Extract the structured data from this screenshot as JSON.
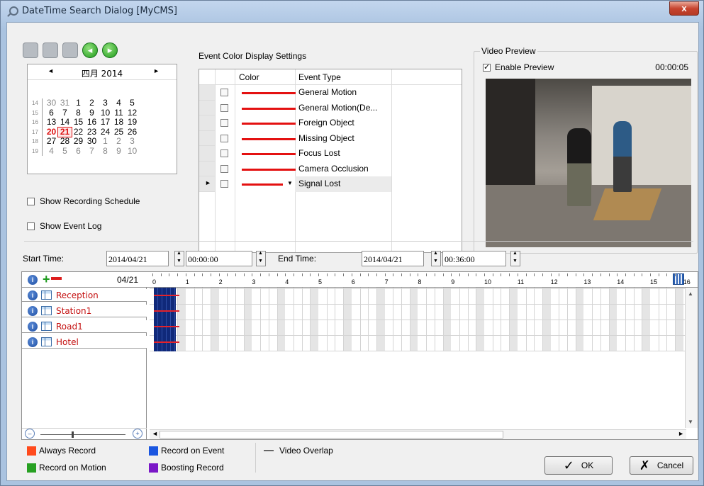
{
  "window": {
    "title": "DateTime Search Dialog [MyCMS]",
    "close_label": "x"
  },
  "toolbar": {
    "icons": [
      "link-icon",
      "search-camera-icon",
      "export-icon",
      "prev-green-icon",
      "next-green-icon"
    ]
  },
  "calendar": {
    "month_label": "四月 2014",
    "prev": "◄",
    "next": "►",
    "weeks": [
      {
        "wk": "14",
        "days": [
          {
            "d": "30",
            "c": "dim"
          },
          {
            "d": "31",
            "c": "dim"
          },
          {
            "d": "1",
            "c": ""
          },
          {
            "d": "2",
            "c": ""
          },
          {
            "d": "3",
            "c": ""
          },
          {
            "d": "4",
            "c": ""
          },
          {
            "d": "5",
            "c": ""
          }
        ]
      },
      {
        "wk": "15",
        "days": [
          {
            "d": "6",
            "c": ""
          },
          {
            "d": "7",
            "c": ""
          },
          {
            "d": "8",
            "c": ""
          },
          {
            "d": "9",
            "c": ""
          },
          {
            "d": "10",
            "c": ""
          },
          {
            "d": "11",
            "c": ""
          },
          {
            "d": "12",
            "c": ""
          }
        ]
      },
      {
        "wk": "16",
        "days": [
          {
            "d": "13",
            "c": ""
          },
          {
            "d": "14",
            "c": ""
          },
          {
            "d": "15",
            "c": ""
          },
          {
            "d": "16",
            "c": ""
          },
          {
            "d": "17",
            "c": ""
          },
          {
            "d": "18",
            "c": ""
          },
          {
            "d": "19",
            "c": ""
          }
        ]
      },
      {
        "wk": "17",
        "days": [
          {
            "d": "20",
            "c": "hl"
          },
          {
            "d": "21",
            "c": "sel"
          },
          {
            "d": "22",
            "c": ""
          },
          {
            "d": "23",
            "c": ""
          },
          {
            "d": "24",
            "c": ""
          },
          {
            "d": "25",
            "c": ""
          },
          {
            "d": "26",
            "c": ""
          }
        ]
      },
      {
        "wk": "18",
        "days": [
          {
            "d": "27",
            "c": ""
          },
          {
            "d": "28",
            "c": ""
          },
          {
            "d": "29",
            "c": ""
          },
          {
            "d": "30",
            "c": ""
          },
          {
            "d": "1",
            "c": "dim"
          },
          {
            "d": "2",
            "c": "dim"
          },
          {
            "d": "3",
            "c": "dim"
          }
        ]
      },
      {
        "wk": "19",
        "days": [
          {
            "d": "4",
            "c": "dim"
          },
          {
            "d": "5",
            "c": "dim"
          },
          {
            "d": "6",
            "c": "dim"
          },
          {
            "d": "7",
            "c": "dim"
          },
          {
            "d": "8",
            "c": "dim"
          },
          {
            "d": "9",
            "c": "dim"
          },
          {
            "d": "10",
            "c": "dim"
          }
        ]
      }
    ]
  },
  "options": {
    "show_recording_schedule": "Show Recording Schedule",
    "show_event_log": "Show Event Log"
  },
  "event_settings": {
    "label": "Event Color Display Settings",
    "col_color": "Color",
    "col_type": "Event Type",
    "line_color": "#e41111",
    "rows": [
      "General Motion",
      "General Motion(De...",
      "Foreign Object",
      "Missing Object",
      "Focus Lost",
      "Camera Occlusion",
      "Signal Lost"
    ]
  },
  "preview": {
    "legend": "Video Preview",
    "enable_label": "Enable Preview",
    "time": "00:00:05"
  },
  "time": {
    "start_label": "Start Time:",
    "start_date": "2014/04/21",
    "start_time": "00:00:00",
    "end_label": "End Time:",
    "end_date": "2014/04/21",
    "end_time": "00:36:00"
  },
  "timeline": {
    "date": "04/21",
    "hours": [
      "0",
      "1",
      "2",
      "3",
      "4",
      "5",
      "6",
      "7",
      "8",
      "9",
      "10",
      "11",
      "12",
      "13",
      "14",
      "15",
      "16"
    ],
    "cameras": [
      "Reception",
      "Station1",
      "Road1",
      "Hotel"
    ]
  },
  "legend": {
    "always": {
      "label": "Always Record",
      "color": "#ff4a1c"
    },
    "motion": {
      "label": "Record on Motion",
      "color": "#27a022"
    },
    "event": {
      "label": "Record on Event",
      "color": "#1a56e0"
    },
    "boosting": {
      "label": "Boosting Record",
      "color": "#7a17c7"
    },
    "overlap": {
      "label": "Video Overlap"
    }
  },
  "buttons": {
    "ok": "OK",
    "cancel": "Cancel"
  }
}
